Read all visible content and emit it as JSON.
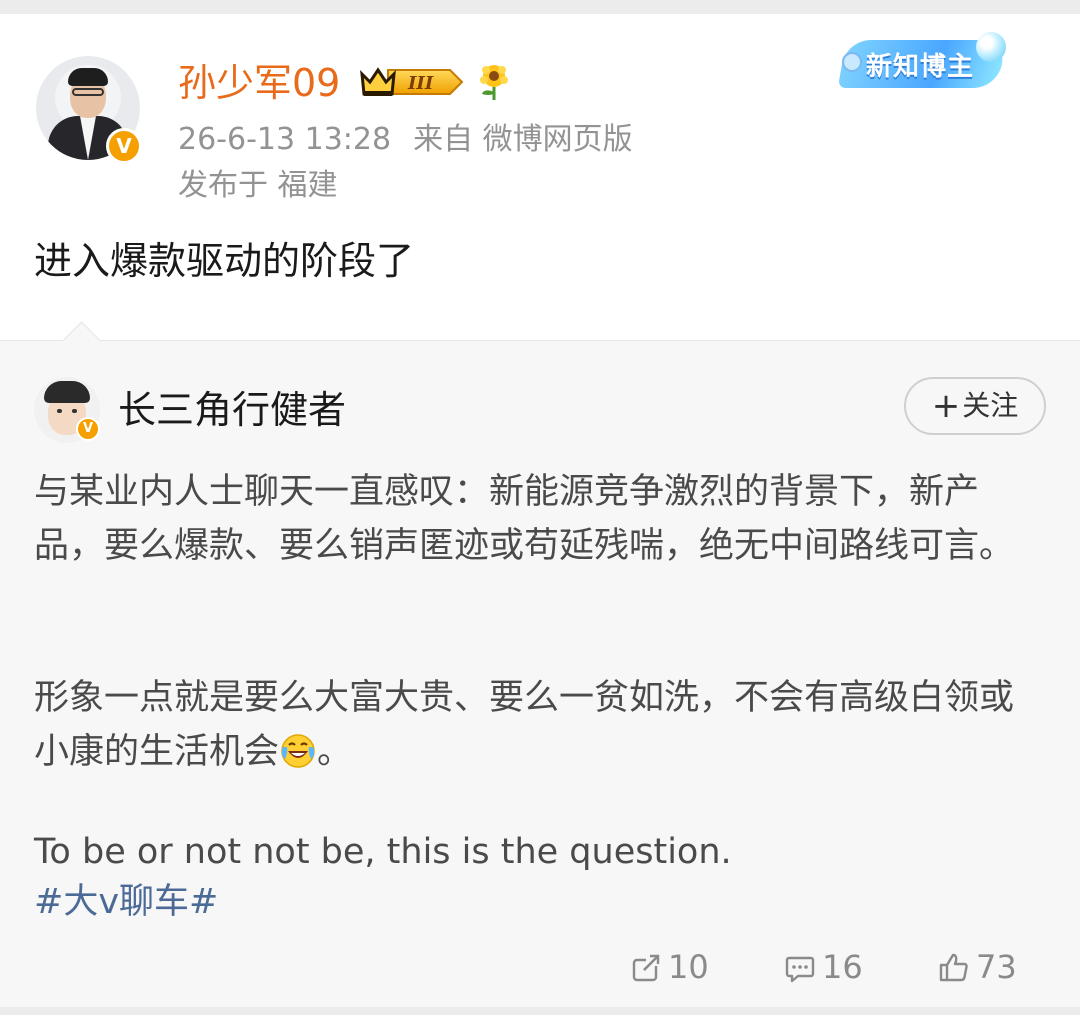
{
  "author": {
    "name": "孙少军09",
    "level_badge": "III",
    "date": "26-6-13 13:28",
    "source": "来自 微博网页版",
    "location": "发布于 福建",
    "tag": "新知博主",
    "verified_mark": "V"
  },
  "post": {
    "text": "进入爆款驱动的阶段了"
  },
  "repost": {
    "author": {
      "name": "长三角行健者",
      "verified_mark": "V"
    },
    "follow_label": "关注",
    "paragraph1": "与某业内人士聊天一直感叹：新能源竞争激烈的背景下，新产品，要么爆款、要么销声匿迹或苟延残喘，绝无中间路线可言。",
    "paragraph2_text": "形象一点就是要么大富大贵、要么一贫如洗，不会有高级白领或小康的生活机会",
    "paragraph2_end": "。",
    "paragraph3": "To be or not not be, this is the question.",
    "hashtag": "#大v聊车#",
    "actions": {
      "repost_count": "10",
      "comment_count": "16",
      "like_count": "73"
    }
  },
  "colors": {
    "username": "#e86b1b",
    "meta": "#939393",
    "hashtag": "#4b6a96",
    "verified": "#f5a000",
    "repost_bg": "#f7f7f7"
  },
  "icons": [
    "crown-badge-icon",
    "sunflower-icon",
    "repost-icon",
    "comment-icon",
    "like-icon",
    "laugh-cry-emoji-icon"
  ]
}
